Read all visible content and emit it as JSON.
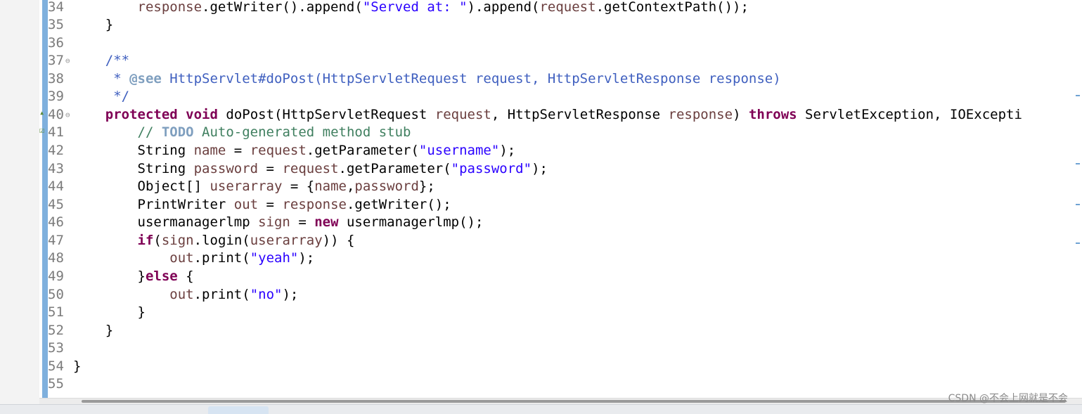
{
  "editor": {
    "lines": [
      {
        "num": "34",
        "text": "        response.getWriter().append(\"Served at: \").append(request.getContextPath());"
      },
      {
        "num": "35",
        "text": "    }"
      },
      {
        "num": "36",
        "text": ""
      },
      {
        "num": "37",
        "text": "    /**",
        "fold": true
      },
      {
        "num": "38",
        "text": "     * @see HttpServlet#doPost(HttpServletRequest request, HttpServletResponse response)"
      },
      {
        "num": "39",
        "text": "     */"
      },
      {
        "num": "40",
        "text": "    protected void doPost(HttpServletRequest request, HttpServletResponse response) throws ServletException, IOExcepti",
        "fold": true,
        "marker": "override"
      },
      {
        "num": "41",
        "text": "        // TODO Auto-generated method stub",
        "marker": "task"
      },
      {
        "num": "42",
        "text": "        String name = request.getParameter(\"username\");"
      },
      {
        "num": "43",
        "text": "        String password = request.getParameter(\"password\");"
      },
      {
        "num": "44",
        "text": "        Object[] userarray = {name,password};"
      },
      {
        "num": "45",
        "text": "        PrintWriter out = response.getWriter();"
      },
      {
        "num": "46",
        "text": "        usermanagerlmp sign = new usermanagerlmp();"
      },
      {
        "num": "47",
        "text": "        if(sign.login(userarray)) {"
      },
      {
        "num": "48",
        "text": "            out.print(\"yeah\");"
      },
      {
        "num": "49",
        "text": "        }else {"
      },
      {
        "num": "50",
        "text": "            out.print(\"no\");"
      },
      {
        "num": "51",
        "text": "        }"
      },
      {
        "num": "52",
        "text": "    }"
      },
      {
        "num": "53",
        "text": ""
      },
      {
        "num": "54",
        "text": "}"
      },
      {
        "num": "55",
        "text": ""
      }
    ]
  },
  "watermark": "CSDN @不会上网就是不会",
  "colors": {
    "keyword": "#7f0055",
    "string": "#2a00ff",
    "comment": "#3f7f5f",
    "javadoc": "#3f5fbf",
    "variable": "#6a3e3e",
    "diff_bar": "#7fb0dd"
  }
}
